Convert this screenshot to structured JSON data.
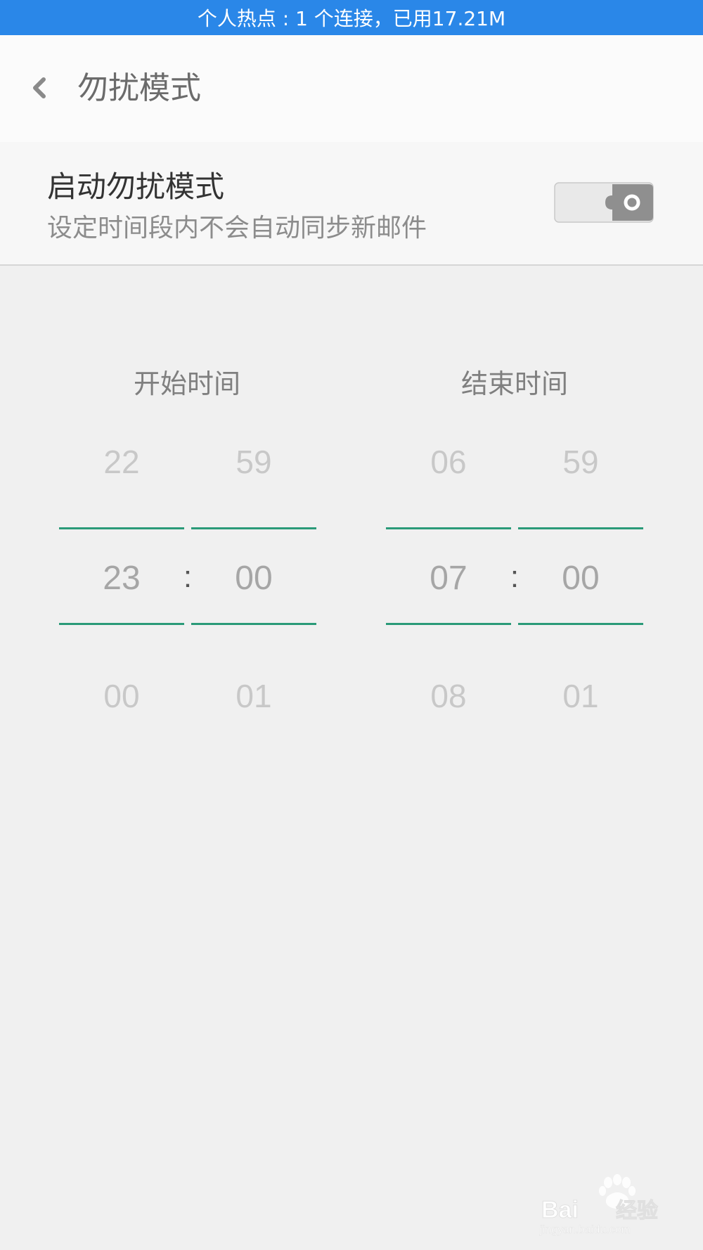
{
  "status_bar": {
    "text": "个人热点 : 1 个连接，已用17.21M"
  },
  "header": {
    "back_icon": "chevron-left-icon",
    "title": "勿扰模式"
  },
  "dnd_setting": {
    "title": "启动勿扰模式",
    "subtitle": "设定时间段内不会自动同步新邮件",
    "enabled": false
  },
  "start_time": {
    "label": "开始时间",
    "hours": {
      "above": "22",
      "selected": "23",
      "below": "00"
    },
    "minutes": {
      "above": "59",
      "selected": "00",
      "below": "01"
    },
    "separator": ":"
  },
  "end_time": {
    "label": "结束时间",
    "hours": {
      "above": "06",
      "selected": "07",
      "below": "08"
    },
    "minutes": {
      "above": "59",
      "selected": "00",
      "below": "01"
    },
    "separator": ":"
  },
  "watermark": {
    "brand": "Baidu经验",
    "url": "jingyan.baidu.com"
  },
  "colors": {
    "status_bar": "#2a87e8",
    "accent_line": "#2a9a78",
    "background": "#f0f0f0"
  }
}
